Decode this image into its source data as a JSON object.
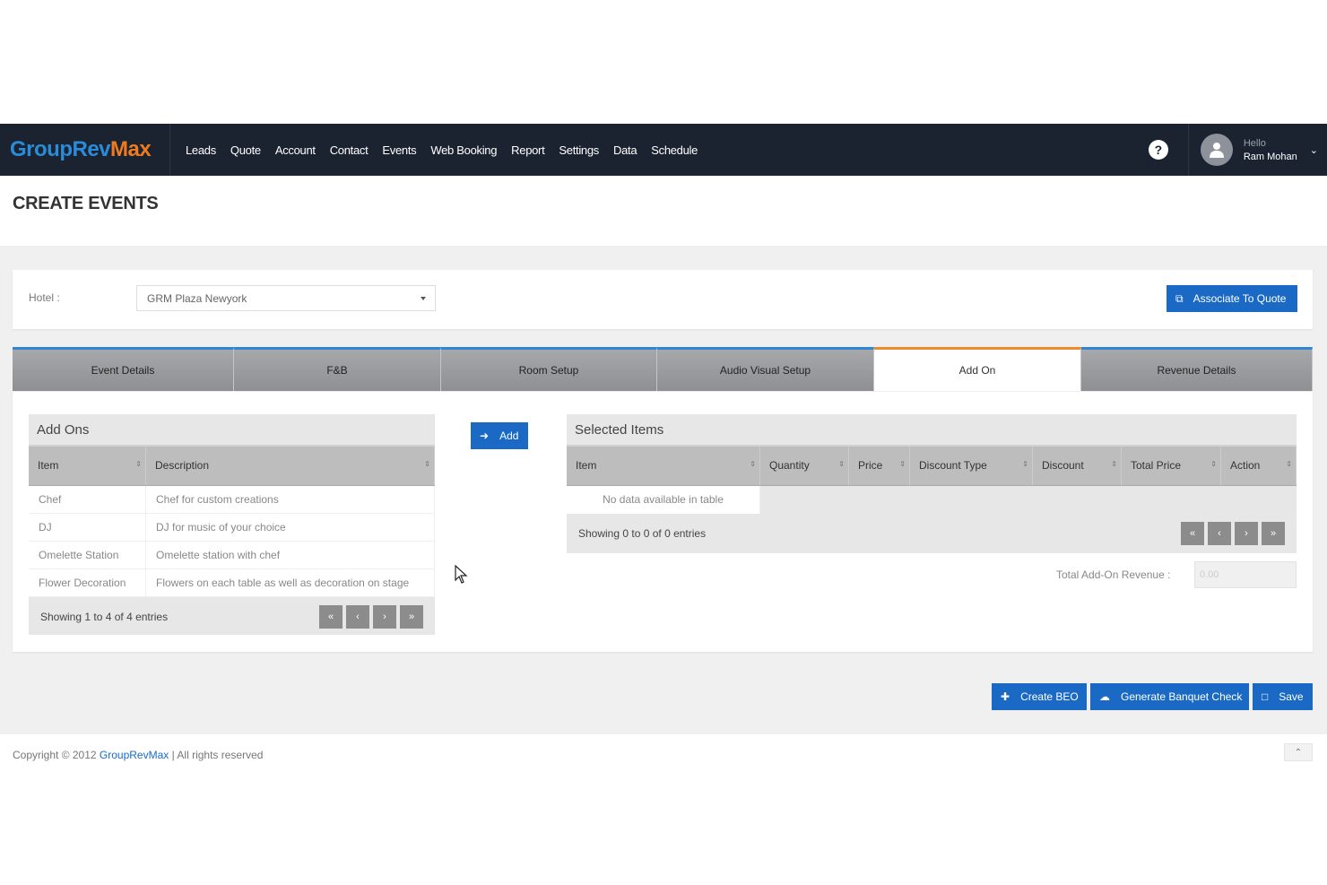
{
  "brand": {
    "part1": "GroupRev",
    "part2": "Max"
  },
  "nav": [
    "Leads",
    "Quote",
    "Account",
    "Contact",
    "Events",
    "Web Booking",
    "Report",
    "Settings",
    "Data",
    "Schedule"
  ],
  "help_icon": "?",
  "user": {
    "greeting": "Hello",
    "name": "Ram Mohan"
  },
  "page_title": "CREATE EVENTS",
  "hotel": {
    "label": "Hotel :",
    "value": "GRM Plaza Newyork"
  },
  "associate_button": "Associate To Quote",
  "tabs": [
    {
      "label": "Event Details"
    },
    {
      "label": "F&B"
    },
    {
      "label": "Room Setup"
    },
    {
      "label": "Audio Visual Setup"
    },
    {
      "label": "Add On"
    },
    {
      "label": "Revenue Details"
    }
  ],
  "addons": {
    "title": "Add Ons",
    "columns": [
      "Item",
      "Description"
    ],
    "rows": [
      {
        "item": "Chef",
        "description": "Chef for custom creations"
      },
      {
        "item": "DJ",
        "description": "DJ for music of your choice"
      },
      {
        "item": "Omelette Station",
        "description": "Omelette station with chef"
      },
      {
        "item": "Flower Decoration",
        "description": "Flowers on each table as well as decoration on stage"
      }
    ],
    "showing": "Showing 1 to 4 of 4 entries"
  },
  "add_button": "Add",
  "selected": {
    "title": "Selected Items",
    "columns": [
      "Item",
      "Quantity",
      "Price",
      "Discount Type",
      "Discount",
      "Total Price",
      "Action"
    ],
    "empty": "No data available in table",
    "showing": "Showing 0 to 0 of 0 entries"
  },
  "pager": [
    "«",
    "‹",
    "›",
    "»"
  ],
  "revenue": {
    "label": "Total Add-On Revenue :",
    "placeholder": "0.00"
  },
  "buttons": {
    "create_beo": "Create BEO",
    "banquet": "Generate Banquet Check",
    "save": "Save"
  },
  "footer": {
    "prefix": "Copyright © 2012 ",
    "link": "GroupRevMax",
    "suffix": " | All rights reserved"
  },
  "colors": {
    "navbar": "#1b2331",
    "accent": "#1a6ac5",
    "tab_active_border": "#f08a2e",
    "tab_border": "#2f86d6"
  }
}
